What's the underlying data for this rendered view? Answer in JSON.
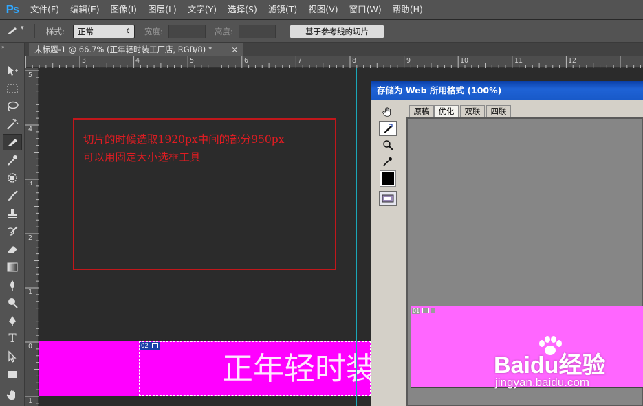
{
  "app": {
    "logo": "Ps"
  },
  "menubar": {
    "items": [
      "文件(F)",
      "编辑(E)",
      "图像(I)",
      "图层(L)",
      "文字(Y)",
      "选择(S)",
      "滤镜(T)",
      "视图(V)",
      "窗口(W)",
      "帮助(H)"
    ]
  },
  "options": {
    "style_label": "样式:",
    "style_value": "正常",
    "width_label": "宽度:",
    "height_label": "高度:",
    "slice_guides_button": "基于参考线的切片"
  },
  "toolbar": {
    "tools": [
      "move-tool",
      "marquee-tool",
      "lasso-tool",
      "magic-wand-tool",
      "slice-tool",
      "eyedropper-tool",
      "spot-healing-tool",
      "brush-tool",
      "clone-stamp-tool",
      "history-brush-tool",
      "eraser-tool",
      "gradient-tool",
      "blur-tool",
      "dodge-tool",
      "pen-tool",
      "type-tool",
      "path-selection-tool",
      "rectangle-tool",
      "hand-tool"
    ],
    "active": "slice-tool"
  },
  "document": {
    "tab_title": "未标题-1 @ 66.7% (正年轻时装工厂店, RGB/8) *",
    "close_symbol": "×"
  },
  "rulers": {
    "horizontal": [
      "3",
      "4",
      "5",
      "6",
      "7",
      "8",
      "9",
      "10",
      "11",
      "12"
    ],
    "vertical": [
      "5",
      "4",
      "3",
      "2",
      "1",
      "0",
      "1"
    ]
  },
  "canvas": {
    "note_line1": "切片的时候选取1920px中间的部分950px",
    "note_line2": "可以用固定大小选框工具",
    "slice_badge": "02",
    "banner_text": "正年轻时装",
    "colors": {
      "banner": "#ff00ff",
      "note": "#e01c22",
      "guide": "#00bcd4"
    }
  },
  "save_for_web": {
    "title": "存储为 Web 所用格式 (100%)",
    "tabs": [
      "原稿",
      "优化",
      "双联",
      "四联"
    ],
    "selected_tab": "优化",
    "preview_slice_badge": "01",
    "preview_color": "#ff66ff"
  },
  "watermark": {
    "brand": "Baidu经验",
    "url": "jingyan.baidu.com"
  }
}
